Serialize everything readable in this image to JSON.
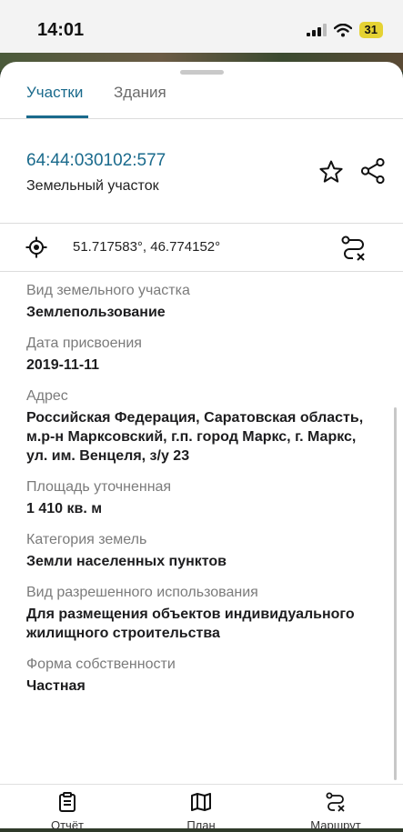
{
  "status_bar": {
    "time": "14:01",
    "battery": "31"
  },
  "tabs": [
    {
      "label": "Участки",
      "active": true
    },
    {
      "label": "Здания",
      "active": false
    }
  ],
  "parcel": {
    "cadastral_number": "64:44:030102:577",
    "type": "Земельный участок",
    "coordinates": "51.717583°, 46.774152°"
  },
  "fields": [
    {
      "label": "Вид земельного участка",
      "value": "Землепользование"
    },
    {
      "label": "Дата присвоения",
      "value": "2019-11-11"
    },
    {
      "label": "Адрес",
      "value": "Российская Федерация, Саратовская область, м.р-н Марксовский, г.п. город Маркс, г. Маркс, ул. им. Венцеля, з/у 23"
    },
    {
      "label": "Площадь уточненная",
      "value": "1 410 кв. м"
    },
    {
      "label": "Категория земель",
      "value": "Земли населенных пунктов"
    },
    {
      "label": "Вид разрешенного использования",
      "value": "Для размещения объектов индивидуального жилищного строительства"
    },
    {
      "label": "Форма собственности",
      "value": "Частная"
    }
  ],
  "bottom_nav": [
    {
      "label": "Отчёт",
      "icon": "clipboard-icon"
    },
    {
      "label": "План",
      "icon": "map-icon"
    },
    {
      "label": "Маршрут",
      "icon": "route-icon"
    }
  ],
  "colors": {
    "accent": "#1a6a8c",
    "label": "#7b7b7b"
  }
}
